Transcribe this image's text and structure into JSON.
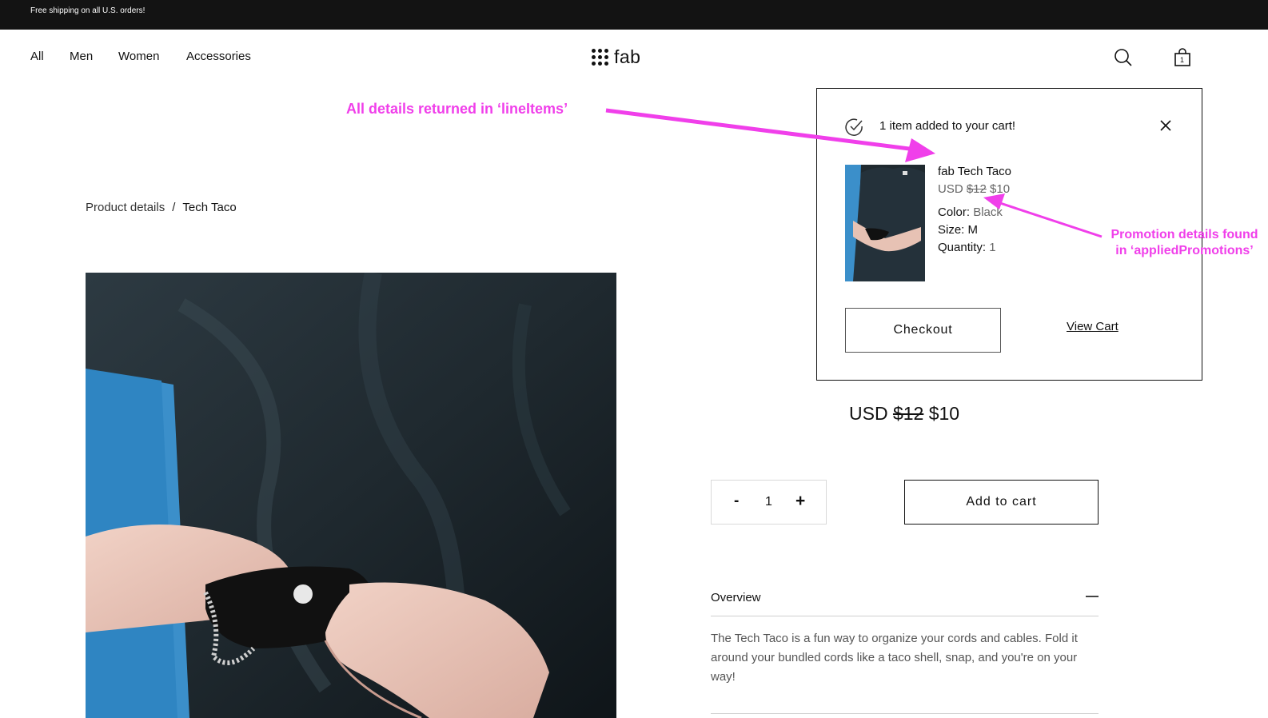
{
  "banner": {
    "text": "Free shipping on all U.S. orders!"
  },
  "nav": {
    "items": [
      "All",
      "Men",
      "Women",
      "Accessories"
    ]
  },
  "logo": {
    "text": "fab"
  },
  "header_icons": {
    "search": "search-icon",
    "cart": "shopping-bag-icon",
    "cart_count": "1"
  },
  "breadcrumb": {
    "parent": "Product details",
    "separator": "/",
    "current": "Tech Taco"
  },
  "product": {
    "currency": "USD",
    "original_price": "$12",
    "sale_price": "$10",
    "quantity": "1",
    "minus_label": "-",
    "plus_label": "+",
    "add_to_cart_label": "Add to cart",
    "overview_label": "Overview",
    "overview_text": "The Tech Taco is a fun way to organize your cords and cables. Fold it around your bundled cords like a taco shell, snap, and you're on your way!"
  },
  "cart_popup": {
    "message": "1 item added to your cart!",
    "product_name": "fab Tech Taco",
    "currency": "USD",
    "original_price": "$12",
    "sale_price": "$10",
    "color_label": "Color:",
    "color_value": "Black",
    "size_label": "Size:",
    "size_value": "M",
    "quantity_label": "Quantity:",
    "quantity_value": "1",
    "checkout_label": "Checkout",
    "view_cart_label": "View Cart"
  },
  "annotations": {
    "line_items": "All details returned in ‘lineItems’",
    "promotions_line1": "Promotion details found",
    "promotions_line2": "in ‘appliedPromotions’",
    "color": "#f03fea"
  }
}
